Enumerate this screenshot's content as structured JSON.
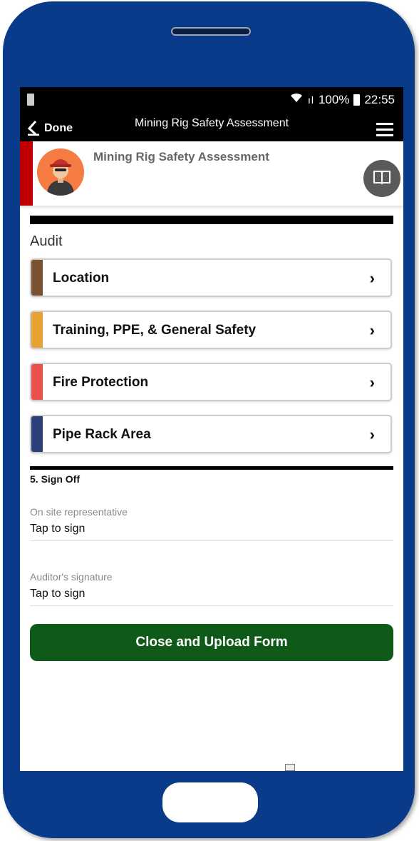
{
  "status": {
    "signal": "ıl",
    "battery_pct": "100%",
    "time": "22:55"
  },
  "nav": {
    "back_label": "Done",
    "title": "Mining Rig Safety Assessment"
  },
  "header": {
    "title": "Mining Rig Safety Assessment"
  },
  "audit": {
    "label": "Audit",
    "sections": [
      {
        "label": "Location",
        "color": "#7a5230"
      },
      {
        "label": "Training, PPE, & General Safety",
        "color": "#e8a233"
      },
      {
        "label": "Fire Protection",
        "color": "#e8524a"
      },
      {
        "label": "Pipe Rack Area",
        "color": "#2e3f7a"
      }
    ],
    "chevron": "›"
  },
  "signoff": {
    "title": "5. Sign Off",
    "fields": [
      {
        "label": "On site representative",
        "value": "Tap to sign"
      },
      {
        "label": "Auditor's signature",
        "value": "Tap to sign"
      }
    ]
  },
  "upload_button": {
    "label": "Close and Upload Form"
  },
  "colors": {
    "phone": "#0a3a8a",
    "header_accent": "#c00000",
    "upload": "#0f5a18"
  }
}
